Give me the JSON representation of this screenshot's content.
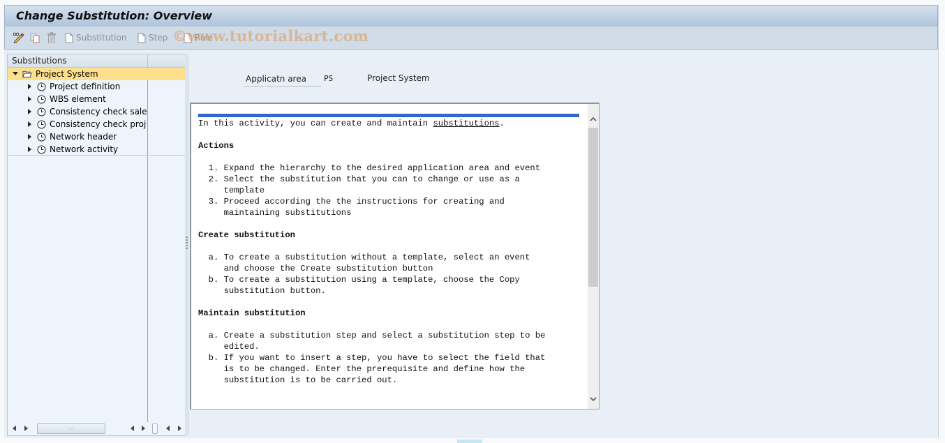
{
  "window": {
    "title": "Change Substitution: Overview"
  },
  "toolbar": {
    "items": [
      {
        "icon": "display-change-icon",
        "label": ""
      },
      {
        "icon": "copy-icon",
        "label": ""
      },
      {
        "icon": "delete-icon",
        "label": ""
      },
      {
        "icon": "document-icon",
        "label": "Substitution"
      },
      {
        "icon": "document-icon",
        "label": "Step"
      },
      {
        "icon": "document-icon",
        "label": "Rule"
      }
    ],
    "watermark": "©www.tutorialkart.com"
  },
  "tree": {
    "header": "Substitutions",
    "root": {
      "label": "Project System",
      "icon": "folder-open-icon",
      "expanded": true
    },
    "children": [
      {
        "label": "Project definition",
        "icon": "clock-icon"
      },
      {
        "label": "WBS element",
        "icon": "clock-icon"
      },
      {
        "label": "Consistency check sales orders",
        "icon": "clock-icon"
      },
      {
        "label": "Consistency check project",
        "icon": "clock-icon"
      },
      {
        "label": "Network header",
        "icon": "clock-icon"
      },
      {
        "label": "Network activity",
        "icon": "clock-icon"
      }
    ]
  },
  "details": {
    "field_label": "Applicatn area",
    "field_value": "PS",
    "field_description": "Project System"
  },
  "documentation": {
    "intro_before": "In this activity, you can create and maintain ",
    "intro_link": "substitutions",
    "intro_after": ".",
    "sections": [
      {
        "heading": "Actions",
        "items": [
          {
            "marker": "1.",
            "lines": [
              "Expand the hierarchy to the desired application area and event"
            ]
          },
          {
            "marker": "2.",
            "lines": [
              "Select the substitution that you can to change or use as a",
              "template"
            ]
          },
          {
            "marker": "3.",
            "lines": [
              "Proceed according the the instructions for creating and",
              "maintaining substitutions"
            ]
          }
        ]
      },
      {
        "heading": "Create substitution",
        "items": [
          {
            "marker": "a.",
            "lines": [
              "To create a substitution without a template, select an event",
              "and choose the Create substitution button"
            ]
          },
          {
            "marker": "b.",
            "lines": [
              "To create a substitution using a template, choose the Copy",
              "substitution button."
            ]
          }
        ]
      },
      {
        "heading": "Maintain substitution",
        "items": [
          {
            "marker": "a.",
            "lines": [
              "Create a substitution step and select a substitution step to be",
              "edited."
            ]
          },
          {
            "marker": "b.",
            "lines": [
              "If you want to insert a step, you have to select the field that",
              "is to be changed. Enter the prerequisite and define how the",
              "substitution is to be carried out."
            ]
          }
        ]
      }
    ]
  }
}
